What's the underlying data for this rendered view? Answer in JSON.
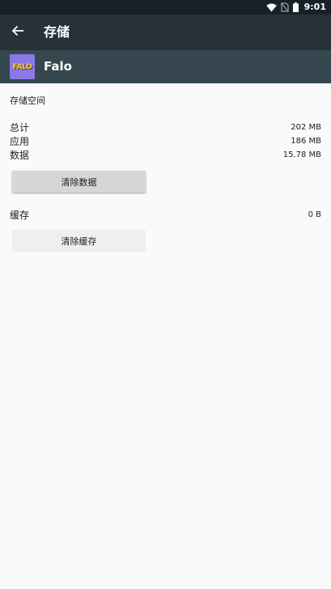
{
  "status_bar": {
    "time": "9:01",
    "icons": [
      "wifi-icon",
      "no-sim-icon",
      "battery-icon"
    ]
  },
  "toolbar": {
    "back_icon": "arrow-back-icon",
    "title": "存储"
  },
  "app": {
    "icon_text": "FALO",
    "name": "Falo"
  },
  "storage": {
    "section_title": "存储空间",
    "rows": [
      {
        "label": "总计",
        "value": "202 MB"
      },
      {
        "label": "应用",
        "value": "186 MB"
      },
      {
        "label": "数据",
        "value": "15.78 MB"
      }
    ],
    "clear_data_label": "清除数据"
  },
  "cache": {
    "label": "缓存",
    "value": "0 B",
    "clear_cache_label": "清除缓存"
  },
  "colors": {
    "status_bar": "#182127",
    "toolbar": "#263238",
    "app_header": "#37474f",
    "background": "#fafafa",
    "app_icon_bg": "#8a77e8",
    "app_icon_text": "#f2d23a"
  }
}
